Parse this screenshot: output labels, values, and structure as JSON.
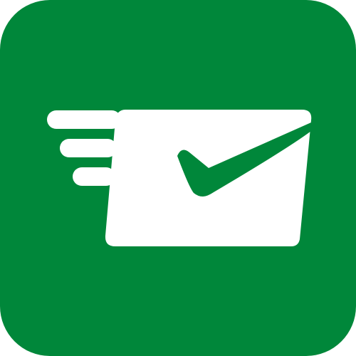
{
  "icon": {
    "name": "sent-mail-check-icon",
    "colors": {
      "background": "#00873A",
      "foreground": "#FFFFFF",
      "check": "#00873A"
    }
  }
}
